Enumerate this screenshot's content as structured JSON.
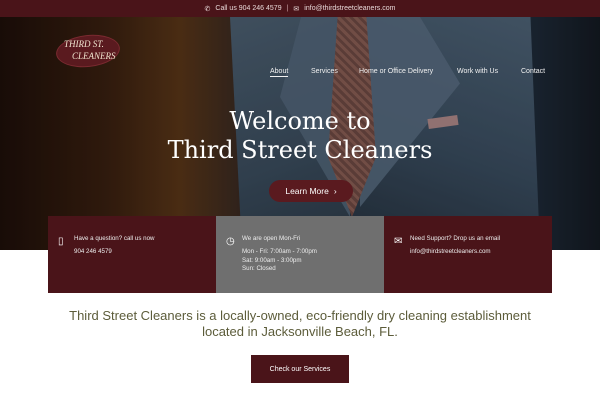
{
  "topbar": {
    "phone_icon": "phone-icon",
    "phone_text": "Call us 904 246 4579",
    "separator": "|",
    "email_icon": "envelope-icon",
    "email_text": "info@thirdstreetcleaners.com",
    "background": "#4a1419"
  },
  "logo": {
    "line1": "THIRD ST.",
    "line2": "CLEANERS"
  },
  "nav": {
    "items": [
      {
        "label": "About",
        "active": true
      },
      {
        "label": "Services",
        "active": false
      },
      {
        "label": "Home or Office Delivery",
        "active": false
      },
      {
        "label": "Work with Us",
        "active": false
      },
      {
        "label": "Contact",
        "active": false
      }
    ]
  },
  "hero": {
    "title_line1": "Welcome to",
    "title_line2": "Third Street Cleaners",
    "button_label": "Learn More",
    "button_icon": "chevron-right-icon",
    "accent": "#5a1a1f"
  },
  "info": [
    {
      "icon": "mobile-phone-icon",
      "title": "Have a question? call us now",
      "lines": [
        "904 246 4579"
      ],
      "color": "#4a1419"
    },
    {
      "icon": "clock-icon",
      "title": "We are open Mon-Fri",
      "lines": [
        "Mon - Fri: 7:00am - 7:00pm",
        "Sat: 9:00am - 3:00pm",
        "Sun: Closed"
      ],
      "color": "#6f6f6f"
    },
    {
      "icon": "envelope-icon",
      "title": "Need Support? Drop us an email",
      "lines": [
        "info@thirdstreetcleaners.com"
      ],
      "color": "#4a1419"
    }
  ],
  "tagline": {
    "line1": "Third Street Cleaners is a locally-owned, eco-friendly dry cleaning establishment",
    "line2": "located in Jacksonville Beach, FL."
  },
  "cta": {
    "label": "Check our Services"
  }
}
